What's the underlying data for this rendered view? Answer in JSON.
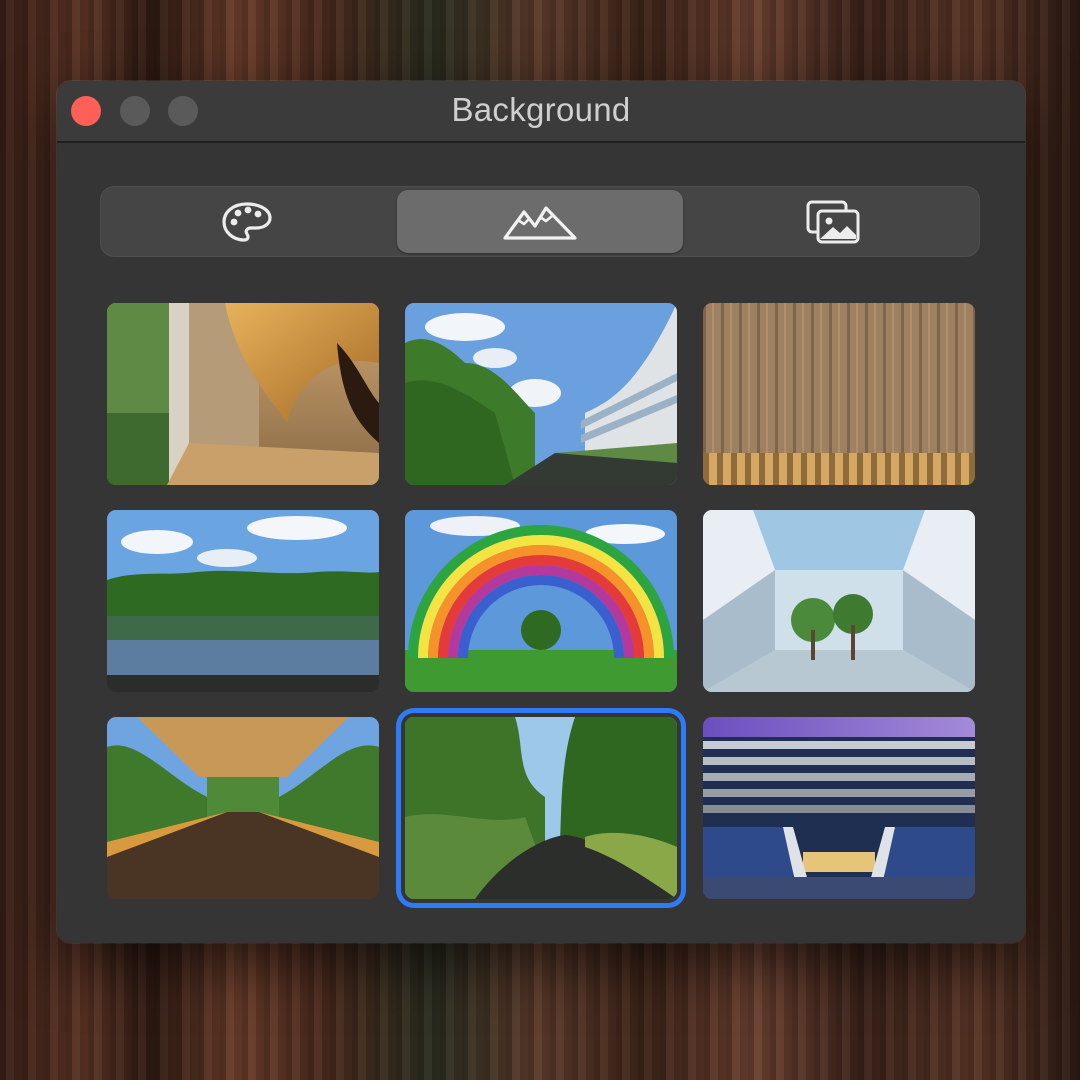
{
  "window": {
    "title": "Background"
  },
  "tabs": [
    {
      "name": "palette",
      "icon": "palette-icon",
      "active": false
    },
    {
      "name": "scenes",
      "icon": "mountains-icon",
      "active": true
    },
    {
      "name": "photos",
      "icon": "photos-icon",
      "active": false
    }
  ],
  "thumbnails": [
    {
      "scene": "wood-staircase-interior",
      "selected": false
    },
    {
      "scene": "curved-building-trees",
      "selected": false
    },
    {
      "scene": "wood-panel-wall",
      "selected": false
    },
    {
      "scene": "pond-forest",
      "selected": false
    },
    {
      "scene": "rainbow-arch",
      "selected": false
    },
    {
      "scene": "atrium-trees",
      "selected": false
    },
    {
      "scene": "wooden-walkway-canopy",
      "selected": false
    },
    {
      "scene": "garden-path",
      "selected": true
    },
    {
      "scene": "auditorium-stairs",
      "selected": false
    }
  ],
  "colors": {
    "selection_ring": "#2f7bf5",
    "close_button": "#fe5f57",
    "window_bg": "#353535",
    "active_segment": "#6c6c6c"
  }
}
